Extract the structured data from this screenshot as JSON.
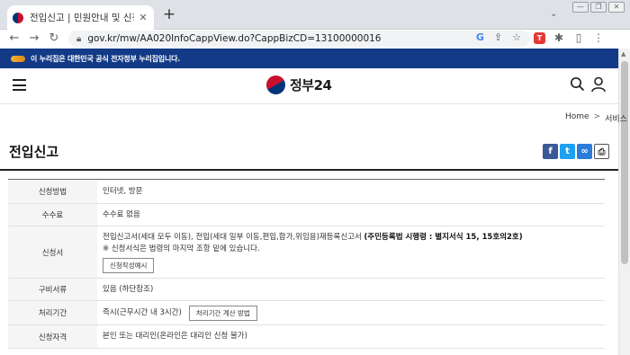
{
  "browser": {
    "tab_title": "전입신고 | 민원안내 및 신청 | 정",
    "tab_close": "✕",
    "new_tab": "+",
    "url": "gov.kr/mw/AA020InfoCappView.do?CappBizCD=13100000016",
    "window_buttons": [
      "—",
      "❐",
      "✕"
    ],
    "icons": [
      "back-icon",
      "forward-icon",
      "reload-icon",
      "lock-icon",
      "google-icon",
      "share-icon",
      "star-icon",
      "extension-icon",
      "puzzle-icon",
      "sidebar-icon",
      "menu-icon"
    ]
  },
  "banner": {
    "text": "이 누리집은 대한민국 공식 전자정부 누리집입니다."
  },
  "header": {
    "brand": "정부24"
  },
  "breadcrumb": {
    "items": [
      "Home",
      "서비스"
    ],
    "separator": ">"
  },
  "page": {
    "title": "전입신고"
  },
  "colors": {
    "banner": "#123a86",
    "facebook": "#3b5998",
    "twitter": "#1da1f2"
  },
  "table": {
    "rows": [
      {
        "label": "신청방법",
        "value": "인터넷, 방문"
      },
      {
        "label": "수수료",
        "value": "수수료 없음"
      },
      {
        "label": "신청서",
        "value_normal": "전입신고서(세대 모두 이동), 전입(세대 일부 이동,편입,합가,위임용)재등록신고서 ",
        "value_bold": "(주민등록법 시행령 : 별지서식 15, 15호의2호)",
        "note": "※ 신청서식은 법령의 마지막 조항 밑에 있습니다.",
        "button": "신청작성예시"
      },
      {
        "label": "구비서류",
        "value": "있음 (하단참조)"
      },
      {
        "label": "처리기간",
        "value": "즉시(근무시간 내 3시간)",
        "button": "처리기간 계산 방법"
      },
      {
        "label": "신청자격",
        "value": "본인 또는 대리인(온라인은 대리인 신청 불가)"
      }
    ]
  }
}
